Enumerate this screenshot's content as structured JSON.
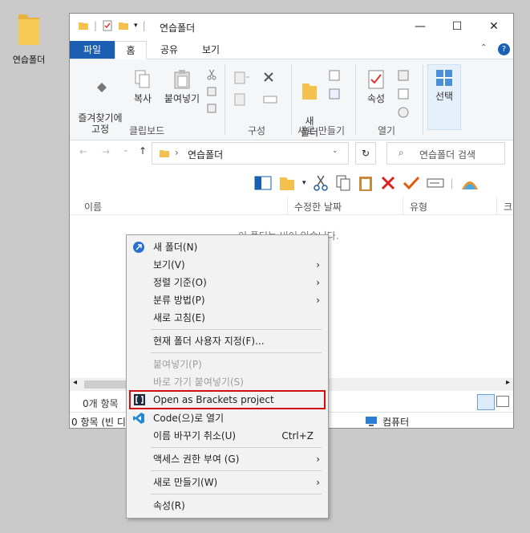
{
  "desktop": {
    "icon_label": "연습폴더"
  },
  "window": {
    "title": "연습폴더",
    "tabs": [
      "파일",
      "홈",
      "공유",
      "보기"
    ],
    "ribbon": {
      "pin_label": "즐겨찾기에\n고정",
      "copy_label": "복사",
      "paste_label": "붙여넣기",
      "clipboard_group": "클립보드",
      "organize_group": "구성",
      "new_folder_label": "새\n폴더",
      "new_group": "새로 만들기",
      "properties_label": "속성",
      "open_group": "열기",
      "select_label": "선택"
    },
    "address": {
      "path": "연습폴더",
      "search_placeholder": "연습폴더 검색"
    },
    "columns": [
      "이름",
      "수정한 날짜",
      "유형",
      "크"
    ],
    "empty_message": "이 폴더는 비어 있습니다.",
    "status_items": "0개 항목",
    "bottom_left": "0 항목 (빈 디",
    "bottom_right": "컴퓨터"
  },
  "context_menu": {
    "items": [
      {
        "label": "새 폴더(N)"
      },
      {
        "label": "보기(V)"
      },
      {
        "label": "정렬 기준(O)"
      },
      {
        "label": "분류 방법(P)"
      },
      {
        "label": "새로 고침(E)"
      },
      {
        "label": "현재 폴더 사용자 지정(F)..."
      },
      {
        "label": "붙여넣기(P)"
      },
      {
        "label": "바로 가기 붙여넣기(S)"
      },
      {
        "label": "Open as Brackets project"
      },
      {
        "label": "Code(으)로 열기"
      },
      {
        "label": "이름 바꾸기 취소(U)",
        "shortcut": "Ctrl+Z"
      },
      {
        "label": "액세스 권한 부여 (G)"
      },
      {
        "label": "새로 만들기(W)"
      },
      {
        "label": "속성(R)"
      }
    ]
  },
  "colors": {
    "accent": "#1a5fb4",
    "highlight": "#d01010",
    "folder": "#f4c14e"
  }
}
